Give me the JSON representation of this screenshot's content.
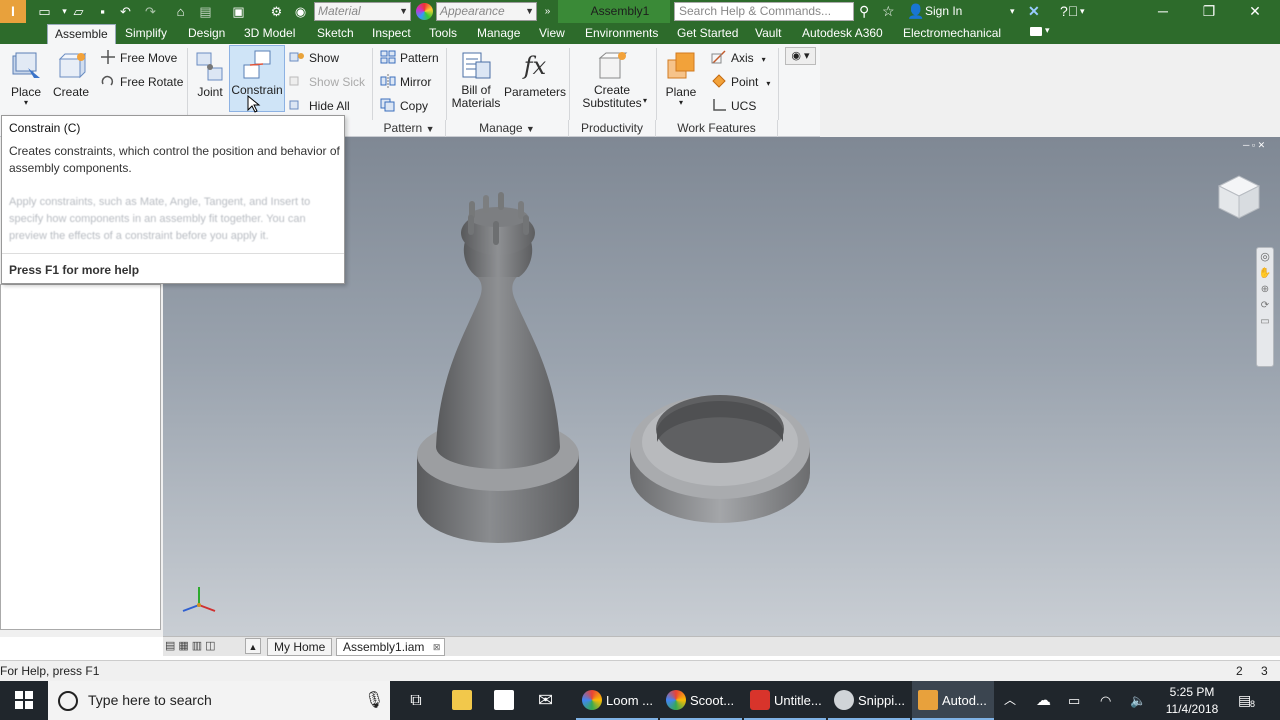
{
  "app": {
    "logo_text": "I",
    "doc_title": "Assembly1",
    "search_placeholder": "Search Help & Commands...",
    "signin": "Sign In"
  },
  "qat": {
    "material": "Material",
    "appearance": "Appearance"
  },
  "tabs": [
    "Assemble",
    "Simplify",
    "Design",
    "3D Model",
    "Sketch",
    "Inspect",
    "Tools",
    "Manage",
    "View",
    "Environments",
    "Get Started",
    "Vault",
    "Autodesk A360",
    "Electromechanical"
  ],
  "ribbon": {
    "place": "Place",
    "create": "Create",
    "free_move": "Free Move",
    "free_rotate": "Free Rotate",
    "joint": "Joint",
    "constrain": "Constrain",
    "show": "Show",
    "show_sick": "Show Sick",
    "hide_all": "Hide All",
    "pattern": "Pattern",
    "mirror": "Mirror",
    "copy": "Copy",
    "bom_1": "Bill of",
    "bom_2": "Materials",
    "parameters": "Parameters",
    "create_sub_1": "Create",
    "create_sub_2": "Substitutes",
    "plane": "Plane",
    "axis": "Axis",
    "point": "Point",
    "ucs": "UCS",
    "panels": {
      "pattern": "Pattern",
      "manage": "Manage",
      "productivity": "Productivity",
      "work_features": "Work Features"
    }
  },
  "tooltip": {
    "title": "Constrain (C)",
    "desc": "Creates constraints, which control the position and behavior of assembly components.",
    "faded": "Apply constraints, such as Mate, Angle, Tangent, and Insert to specify how components in an assembly fit together. You can preview the effects of a constraint before you apply it.",
    "help": "Press F1 for more help"
  },
  "doc_tabs": {
    "home": "My Home",
    "assembly": "Assembly1.iam"
  },
  "status": {
    "help": "For Help, press F1",
    "count1": "2",
    "count2": "3"
  },
  "taskbar": {
    "search": "Type here to search",
    "items": [
      "Loom ...",
      "Scoot...",
      "Untitle...",
      "Snippi...",
      "Autod..."
    ],
    "time": "5:25 PM",
    "date": "11/4/2018",
    "notif": "8"
  },
  "colors": {
    "titlebar": "#2d6b2b",
    "accent": "#8db2e3"
  }
}
